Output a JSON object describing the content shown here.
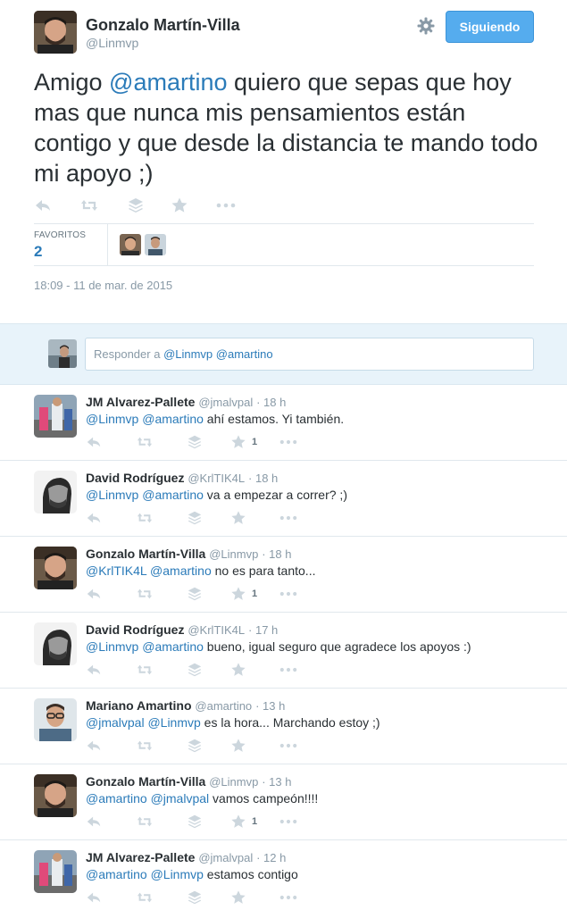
{
  "tweet": {
    "author_name": "Gonzalo Martín-Villa",
    "author_handle": "@Linmvp",
    "follow_label": "Siguiendo",
    "text_prefix": "Amigo ",
    "text_mention": "@amartino",
    "text_rest": " quiero que sepas que hoy mas que nunca mis pensamientos están contigo y que desde la distancia te mando todo mi apoyo ;)",
    "favorites_label": "FAVORITOS",
    "favorites_count": "2",
    "timestamp": "18:09 - 11 de mar. de 2015"
  },
  "reply_box": {
    "prefix": "Responder a ",
    "mentions": "@Linmvp @amartino"
  },
  "replies": [
    {
      "name": "JM Alvarez-Pallete",
      "handle": "@jmalvpal",
      "time": "· 18 h",
      "mentions": "@Linmvp @amartino",
      "text": " ahí estamos. Yi también.",
      "fav_count": "1"
    },
    {
      "name": "David Rodríguez",
      "handle": "@KrlTIK4L",
      "time": "· 18 h",
      "mentions": "@Linmvp @amartino",
      "text": " va a empezar a correr? ;)",
      "fav_count": ""
    },
    {
      "name": "Gonzalo Martín-Villa",
      "handle": "@Linmvp",
      "time": "· 18 h",
      "mentions": "@KrlTIK4L @amartino",
      "text": " no es para tanto...",
      "fav_count": "1"
    },
    {
      "name": "David Rodríguez",
      "handle": "@KrlTIK4L",
      "time": "· 17 h",
      "mentions": "@Linmvp @amartino",
      "text": " bueno, igual seguro que agradece los apoyos :)",
      "fav_count": ""
    },
    {
      "name": "Mariano Amartino",
      "handle": "@amartino",
      "time": "· 13 h",
      "mentions": "@jmalvpal @Linmvp",
      "text": " es la hora... Marchando estoy ;)",
      "fav_count": ""
    },
    {
      "name": "Gonzalo Martín-Villa",
      "handle": "@Linmvp",
      "time": "· 13 h",
      "mentions": "@amartino @jmalvpal",
      "text": " vamos campeón!!!!",
      "fav_count": "1"
    },
    {
      "name": "JM Alvarez-Pallete",
      "handle": "@jmalvpal",
      "time": "· 12 h",
      "mentions": "@amartino @Linmvp",
      "text": " estamos contigo",
      "fav_count": ""
    }
  ],
  "colors": {
    "accent": "#55acee",
    "link": "#2b7bb9",
    "muted": "#8899a6",
    "icon": "#aab8c2",
    "reply_bar": "#e8f3fa"
  },
  "icons": [
    "reply-icon",
    "retweet-icon",
    "buffer-icon",
    "favorite-icon",
    "more-icon",
    "gear-icon"
  ]
}
